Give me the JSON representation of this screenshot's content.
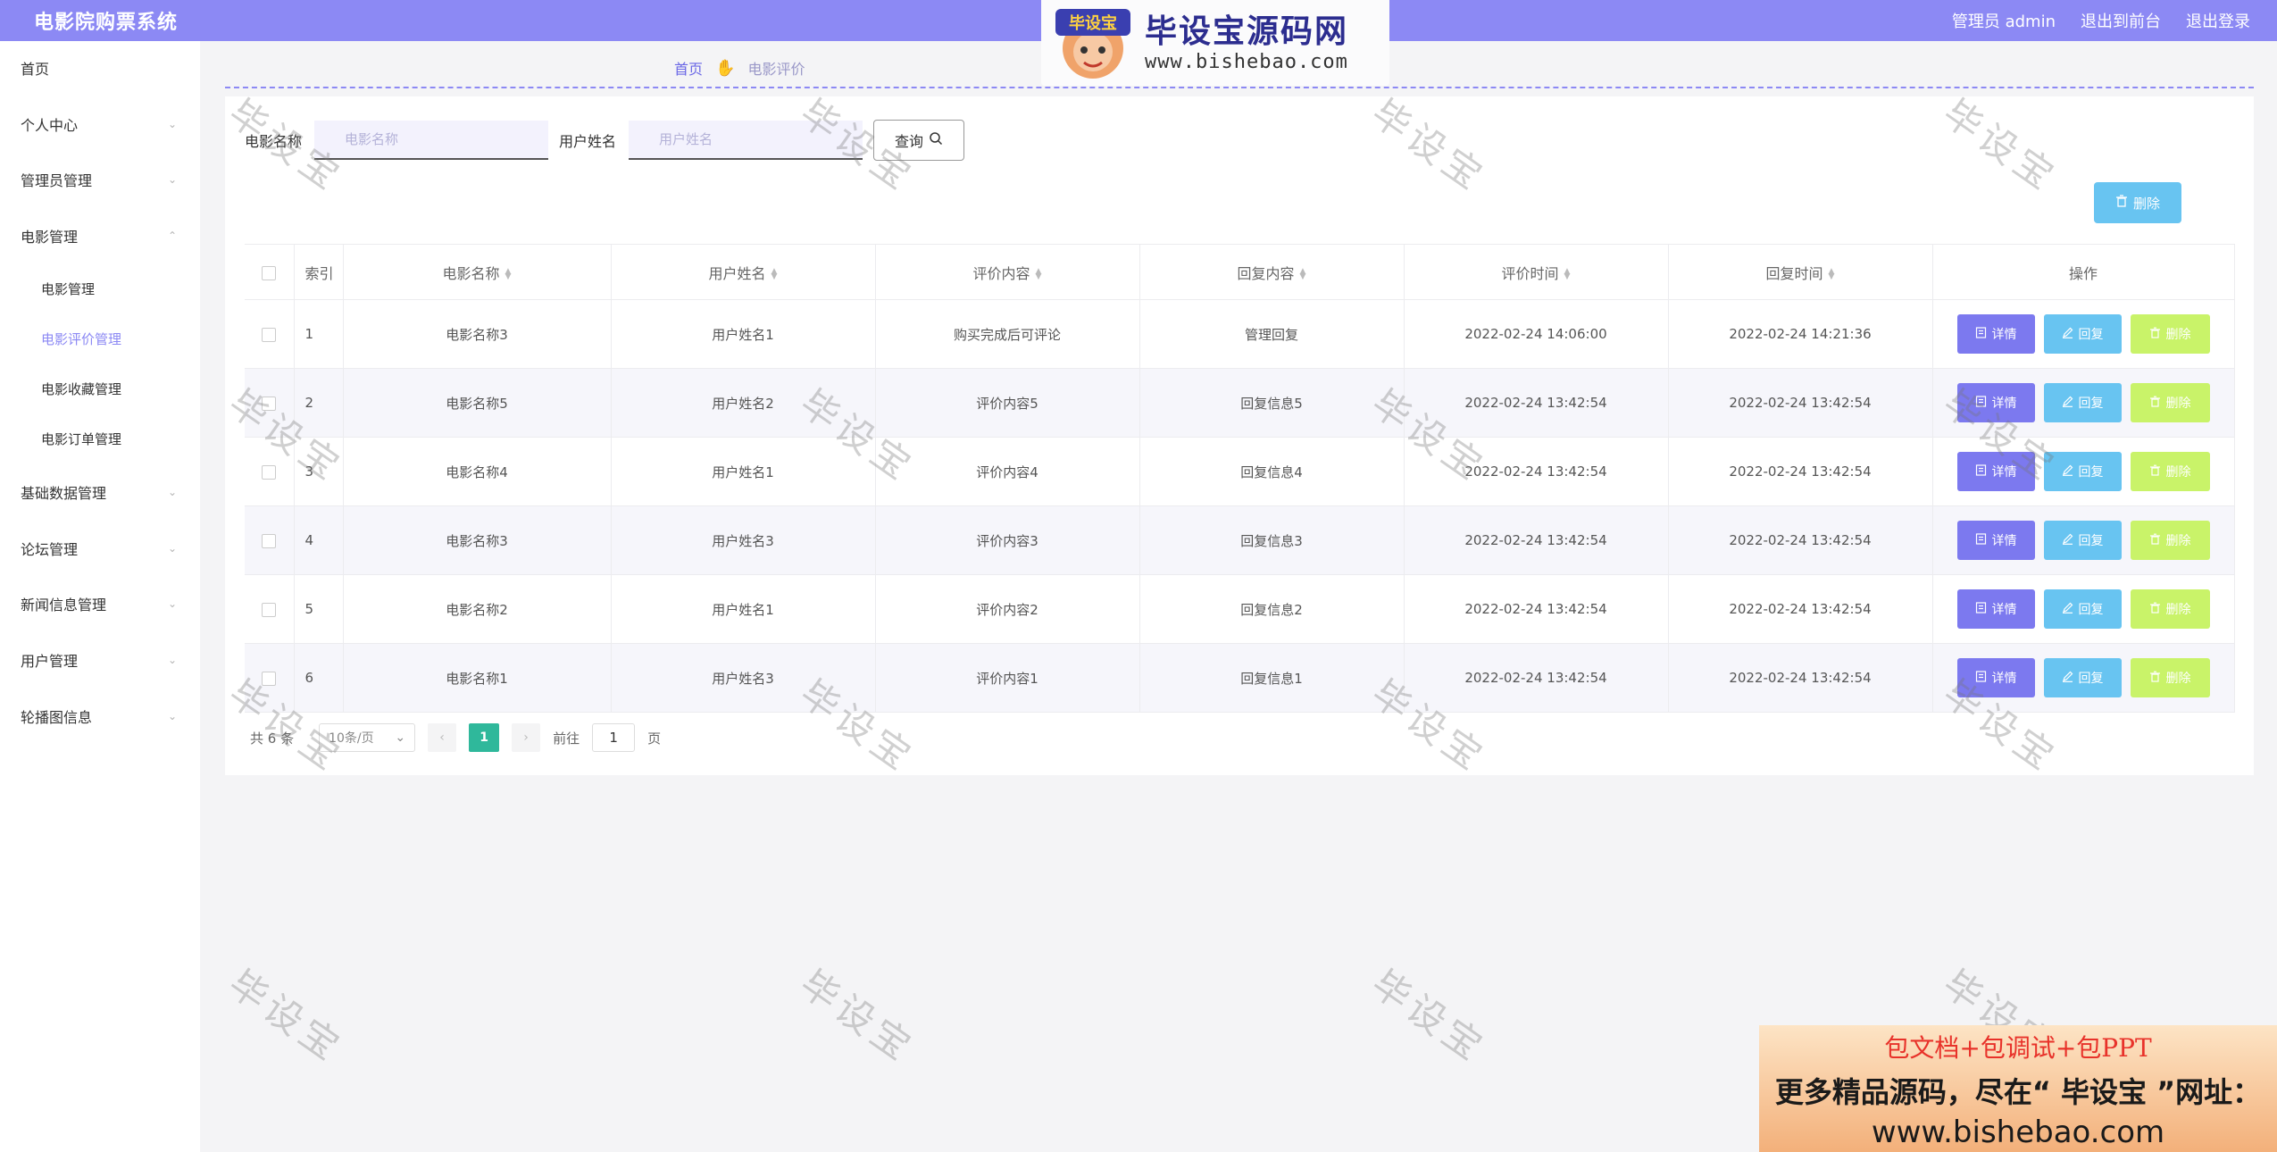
{
  "header": {
    "title": "电影院购票系统",
    "admin_label": "管理员 admin",
    "front_link": "退出到前台",
    "logout": "退出登录"
  },
  "logo": {
    "main": "毕设宝源码网",
    "url": "www.bishebao.com",
    "badge": "毕设宝"
  },
  "sidebar": {
    "items": [
      {
        "label": "首页",
        "chevron": false
      },
      {
        "label": "个人中心",
        "chevron": true
      },
      {
        "label": "管理员管理",
        "chevron": true
      },
      {
        "label": "电影管理",
        "chevron": true,
        "expanded": true
      },
      {
        "label": "电影管理",
        "sub": true
      },
      {
        "label": "电影评价管理",
        "sub": true,
        "active": true
      },
      {
        "label": "电影收藏管理",
        "sub": true
      },
      {
        "label": "电影订单管理",
        "sub": true
      },
      {
        "label": "基础数据管理",
        "chevron": true
      },
      {
        "label": "论坛管理",
        "chevron": true
      },
      {
        "label": "新闻信息管理",
        "chevron": true
      },
      {
        "label": "用户管理",
        "chevron": true
      },
      {
        "label": "轮播图信息",
        "chevron": true
      }
    ]
  },
  "breadcrumb": {
    "home": "首页",
    "current": "电影评价"
  },
  "search": {
    "movie_label": "电影名称",
    "movie_placeholder": "电影名称",
    "user_label": "用户姓名",
    "user_placeholder": "用户姓名",
    "query_button": "查询"
  },
  "batch_delete": "删除",
  "table": {
    "columns": [
      "索引",
      "电影名称",
      "用户姓名",
      "评价内容",
      "回复内容",
      "评价时间",
      "回复时间",
      "操作"
    ],
    "rows": [
      {
        "index": "1",
        "movie": "电影名称3",
        "user": "用户姓名1",
        "content": "购买完成后可评论",
        "reply": "管理回复",
        "eval_time": "2022-02-24 14:06:00",
        "reply_time": "2022-02-24 14:21:36"
      },
      {
        "index": "2",
        "movie": "电影名称5",
        "user": "用户姓名2",
        "content": "评价内容5",
        "reply": "回复信息5",
        "eval_time": "2022-02-24 13:42:54",
        "reply_time": "2022-02-24 13:42:54"
      },
      {
        "index": "3",
        "movie": "电影名称4",
        "user": "用户姓名1",
        "content": "评价内容4",
        "reply": "回复信息4",
        "eval_time": "2022-02-24 13:42:54",
        "reply_time": "2022-02-24 13:42:54"
      },
      {
        "index": "4",
        "movie": "电影名称3",
        "user": "用户姓名3",
        "content": "评价内容3",
        "reply": "回复信息3",
        "eval_time": "2022-02-24 13:42:54",
        "reply_time": "2022-02-24 13:42:54"
      },
      {
        "index": "5",
        "movie": "电影名称2",
        "user": "用户姓名1",
        "content": "评价内容2",
        "reply": "回复信息2",
        "eval_time": "2022-02-24 13:42:54",
        "reply_time": "2022-02-24 13:42:54"
      },
      {
        "index": "6",
        "movie": "电影名称1",
        "user": "用户姓名3",
        "content": "评价内容1",
        "reply": "回复信息1",
        "eval_time": "2022-02-24 13:42:54",
        "reply_time": "2022-02-24 13:42:54"
      }
    ],
    "actions": {
      "detail": "详情",
      "reply": "回复",
      "delete": "删除"
    }
  },
  "pagination": {
    "total": "共 6 条",
    "page_size": "10条/页",
    "current_page": "1",
    "goto_label": "前往",
    "goto_value": "1",
    "page_suffix": "页"
  },
  "ad": {
    "line1": "包文档+包调试+包PPT",
    "line2": "更多精品源码，尽在“ 毕设宝 ”网址：",
    "line3": "www.bishebao.com"
  },
  "watermark": "毕设宝",
  "colors": {
    "accent": "#8c89f4",
    "detail_button": "#7c79ef",
    "reply_button": "#68c4f1",
    "delete_button": "#c9f369",
    "current_page": "#2fb89b"
  }
}
